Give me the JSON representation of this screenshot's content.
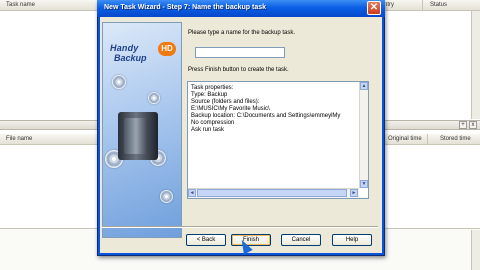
{
  "background": {
    "columns_top": [
      "Task name",
      "Entry",
      "Status"
    ],
    "columns_bottom": [
      "File name",
      "Original time",
      "Stored time"
    ],
    "pin_glyph": "+",
    "close_glyph": "x"
  },
  "dialog": {
    "title": "New Task Wizard - Step 7: Name the backup task",
    "close_glyph": "✕",
    "logo_line1": "Handy",
    "logo_line2": "Backup",
    "logo_badge": "HD",
    "prompt": "Please type a name for the backup task.",
    "task_name_value": "",
    "finish_hint": "Press Finish button to create the task.",
    "properties_lines": [
      "Task properties:",
      "   Type: Backup",
      "   Source (folders and files):",
      "      E:\\MUSIC\\My Favorite Music\\",
      "   Backup location: C:\\Documents and Settings\\emmeylMy",
      "   No compression",
      "      Ask run task"
    ],
    "buttons": {
      "back": "< Back",
      "finish": "Finish",
      "cancel": "Cancel",
      "help": "Help"
    },
    "scroll_arrows": {
      "up": "▲",
      "down": "▼",
      "left": "◄",
      "right": "►"
    }
  }
}
